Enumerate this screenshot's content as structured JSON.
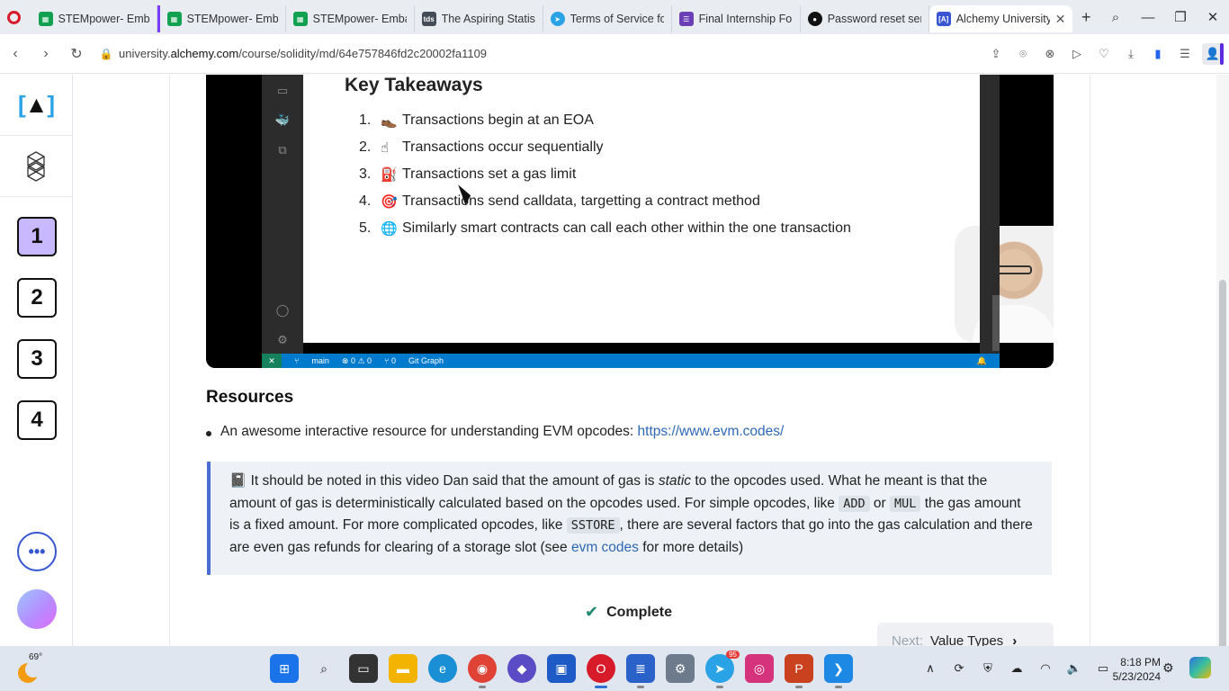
{
  "browser": {
    "tabs": [
      {
        "label": "STEMpower- Emba",
        "fav_color": "#12a150"
      },
      {
        "label": "STEMpower- Emba",
        "fav_color": "#12a150"
      },
      {
        "label": "STEMpower- Emba",
        "fav_color": "#12a150"
      },
      {
        "label": "The Aspiring Statist",
        "fav_color": "#444c57",
        "fav_text": "tds"
      },
      {
        "label": "Terms of Service fo",
        "fav_color": "#2aa3e6"
      },
      {
        "label": "Final Internship For",
        "fav_color": "#6b3fb5"
      },
      {
        "label": "Password reset sent",
        "fav_color": "#111111"
      },
      {
        "label": "Alchemy University",
        "fav_color": "#3856d1",
        "fav_text": "[A]"
      }
    ],
    "url_prefix": "university.",
    "url_domain": "alchemy.com",
    "url_path": "/course/solidity/md/64e757846fd2c20002fa1109"
  },
  "sidebar": {
    "logo": "[A]",
    "steps": [
      "1",
      "2",
      "3",
      "4"
    ],
    "more": "•••"
  },
  "video": {
    "slide_title": "Key Takeaways",
    "takeaways": [
      {
        "num": "1.",
        "emoji": "👞",
        "text": "Transactions begin at an EOA"
      },
      {
        "num": "2.",
        "emoji": "☝",
        "text": "Transactions occur sequentially"
      },
      {
        "num": "3.",
        "emoji": "⛽",
        "text": "Transactions set a gas limit"
      },
      {
        "num": "4.",
        "emoji": "🎯",
        "text": "Transactions send calldata, targetting a contract method"
      },
      {
        "num": "5.",
        "emoji": "🌐",
        "text": "Similarly smart contracts can call each other within the one transaction"
      }
    ],
    "status": {
      "branch": "main",
      "problems": "⊗ 0 ⚠ 0",
      "ports": "⑂ 0",
      "git": "Git Graph"
    }
  },
  "resources": {
    "heading": "Resources",
    "item_text": "An awesome interactive resource for understanding EVM opcodes: ",
    "item_link": "https://www.evm.codes/"
  },
  "note": {
    "icon": "📓",
    "p1": " It should be noted in this video Dan said that the amount of gas is ",
    "em": "static",
    "p2": " to the opcodes used. What he meant is that the amount of gas is deterministically calculated based on the opcodes used. For simple opcodes, like ",
    "code1": "ADD",
    "p3": " or ",
    "code2": "MUL",
    "p4": " the gas amount is a fixed amount. For more complicated opcodes, like ",
    "code3": "SSTORE",
    "p5": ", there are several factors that go into the gas calculation and there are even gas refunds for clearing of a storage slot (see ",
    "link": "evm codes",
    "p6": " for more details)"
  },
  "actions": {
    "complete": "Complete",
    "next_label": "Next:",
    "next_value": "Value Types"
  },
  "taskbar": {
    "temperature": "69°",
    "time": "8:18 PM",
    "date": "5/23/2024",
    "telegram_badge": "95"
  }
}
